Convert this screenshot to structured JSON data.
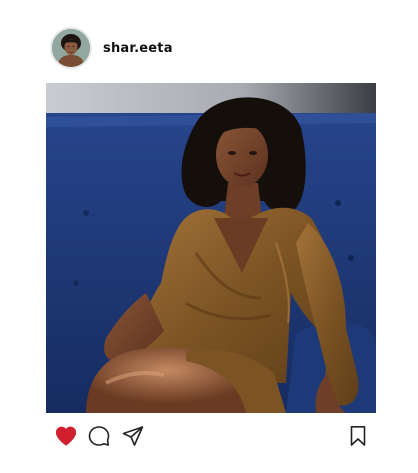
{
  "post": {
    "username": "shar.eeta",
    "liked": true,
    "colors": {
      "like_active": "#d0202f",
      "icon_stroke": "#222222"
    },
    "icons": {
      "avatar": "profile-photo",
      "like": "heart-icon",
      "comment": "comment-bubble-icon",
      "share": "paper-plane-icon",
      "save": "bookmark-icon"
    }
  }
}
